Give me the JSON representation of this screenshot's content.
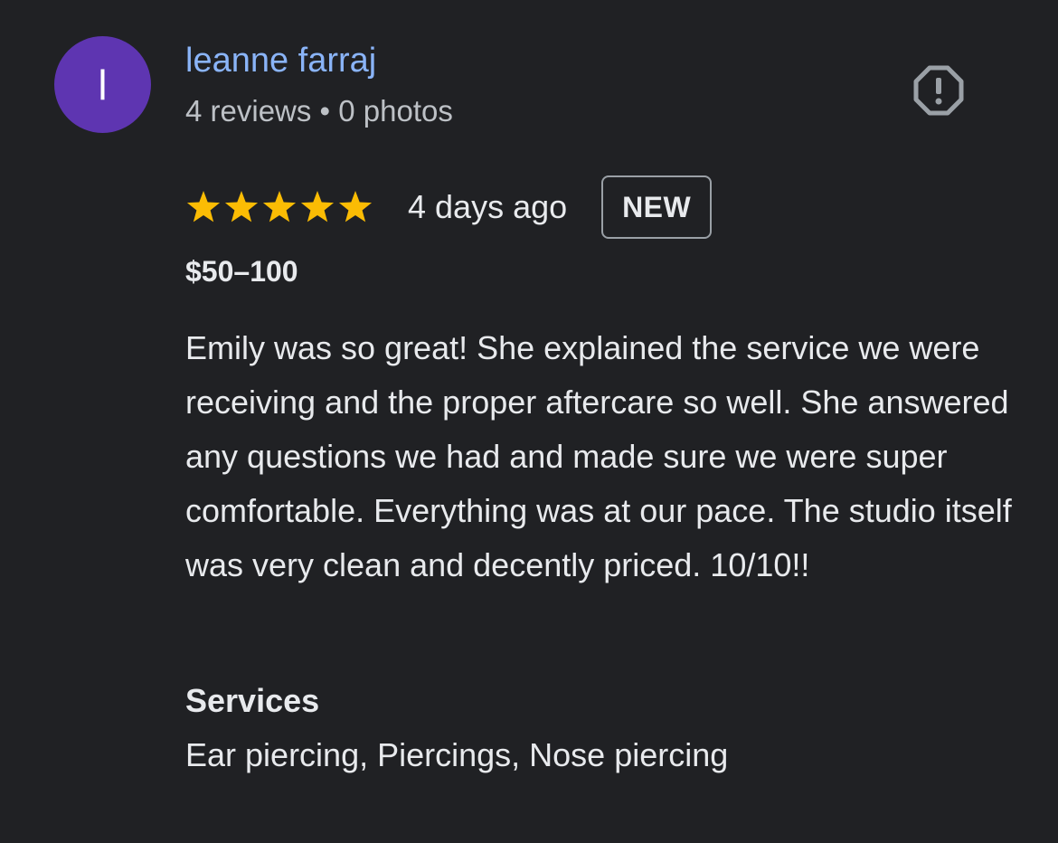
{
  "reviewer": {
    "avatar_initial": "l",
    "avatar_color": "#5e35b1",
    "name": "leanne farraj",
    "meta": "4 reviews • 0 photos"
  },
  "report": {
    "icon": "report-octagon-icon"
  },
  "review": {
    "rating": 5,
    "rating_max": 5,
    "star_color": "#fbbc04",
    "date": "4 days ago",
    "badge": "NEW",
    "price": "$50–100",
    "text": "Emily was so great! She explained the service we were receiving and the proper aftercare so well. She answered any questions we had and made sure we were super comfortable. Everything was at our pace. The studio itself was very clean and decently priced. 10/10!!"
  },
  "services": {
    "heading": "Services",
    "list": "Ear piercing, Piercings, Nose piercing"
  }
}
